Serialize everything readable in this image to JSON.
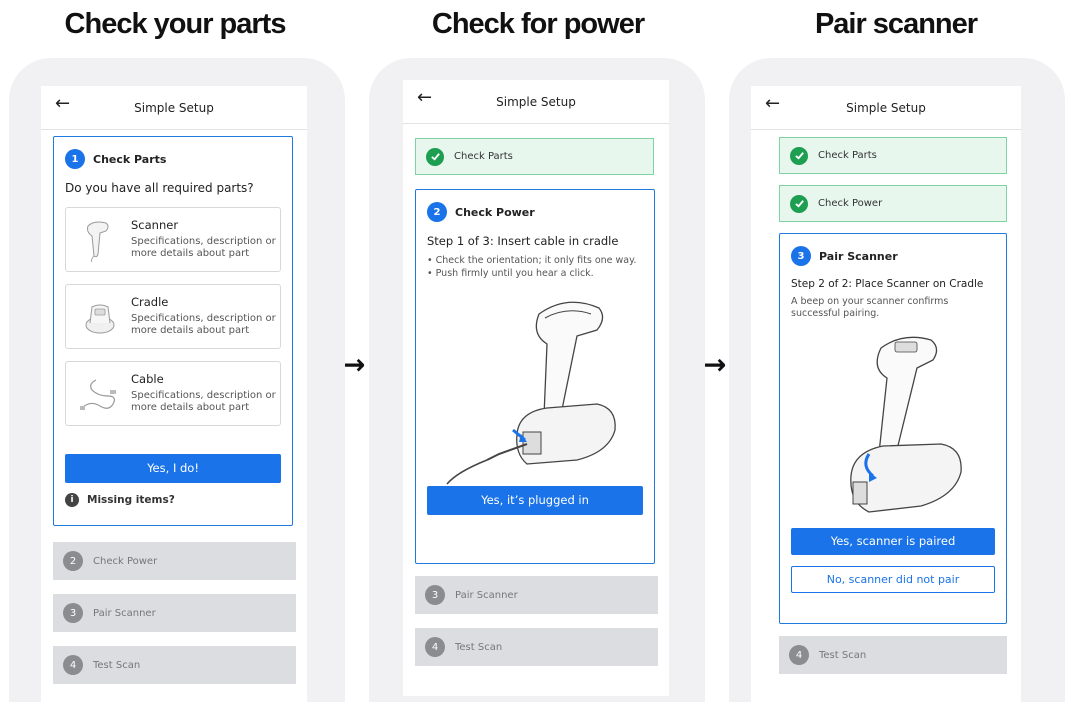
{
  "panels": [
    {
      "title": "Check your parts"
    },
    {
      "title": "Check for power"
    },
    {
      "title": "Pair scanner"
    }
  ],
  "appbar": {
    "title": "Simple Setup",
    "back_icon": "arrow-left-icon"
  },
  "arrow_glyph": "→",
  "screen1": {
    "active_step": {
      "num": "1",
      "label": "Check Parts"
    },
    "question": "Do you have all required parts?",
    "parts": [
      {
        "name": "Scanner",
        "desc": "Specifications, description or more details about part",
        "icon": "scanner-icon"
      },
      {
        "name": "Cradle",
        "desc": "Specifications, description or more details about part",
        "icon": "cradle-icon"
      },
      {
        "name": "Cable",
        "desc": "Specifications, description or more details about part",
        "icon": "cable-icon"
      }
    ],
    "confirm_label": "Yes, I do!",
    "missing_label": "Missing items?",
    "info_glyph": "i",
    "pending": [
      {
        "num": "2",
        "label": "Check Power"
      },
      {
        "num": "3",
        "label": "Pair Scanner"
      },
      {
        "num": "4",
        "label": "Test Scan"
      }
    ]
  },
  "screen2": {
    "done": [
      {
        "label": "Check Parts"
      }
    ],
    "active_step": {
      "num": "2",
      "label": "Check Power"
    },
    "step_line": "Step 1 of 3: Insert cable in cradle",
    "bullets": [
      "Check the orientation; it only fits one way.",
      "Push firmly until you hear a click."
    ],
    "confirm_label": "Yes, it’s plugged in",
    "pending": [
      {
        "num": "3",
        "label": "Pair Scanner"
      },
      {
        "num": "4",
        "label": "Test Scan"
      }
    ]
  },
  "screen3": {
    "done": [
      {
        "label": "Check Parts"
      },
      {
        "label": "Check Power"
      }
    ],
    "active_step": {
      "num": "3",
      "label": "Pair Scanner"
    },
    "step_line": "Step 2 of 2: Place Scanner on Cradle",
    "note": "A beep on your scanner confirms successful pairing.",
    "confirm_label": "Yes, scanner is paired",
    "deny_label": "No, scanner did not pair",
    "pending": [
      {
        "num": "4",
        "label": "Test Scan"
      }
    ]
  },
  "colors": {
    "accent": "#1a73e8",
    "success": "#1e9e50",
    "success_bg": "#e8f7ee",
    "pending_bg": "#dcdde0"
  }
}
